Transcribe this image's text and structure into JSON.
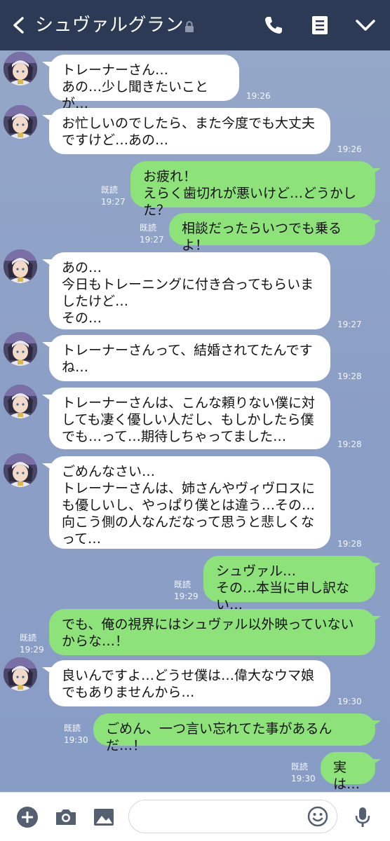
{
  "header": {
    "title": "シュヴァルグラン",
    "icons": [
      "back-icon",
      "lock-icon",
      "phone-icon",
      "menu-note-icon",
      "chevron-down-icon"
    ]
  },
  "colors": {
    "header_bg": "#2c3a55",
    "chat_bg": "#8a9ec3",
    "my_bubble": "#8ee27a",
    "their_bubble": "#ffffff"
  },
  "messages": [
    {
      "side": "left",
      "text": "トレーナーさん…\nあの…少し聞きたいことが…",
      "time": "19:26"
    },
    {
      "side": "left",
      "text": "お忙しいのでしたら、また今度でも大丈夫\nですけど…あの…",
      "time": "19:26"
    },
    {
      "side": "right",
      "text": "お疲れ！\nえらく歯切れが悪いけど…どうかした？",
      "time": "19:27",
      "read": "既読"
    },
    {
      "side": "right",
      "text": "相談だったらいつでも乗るよ！",
      "time": "19:27",
      "read": "既読"
    },
    {
      "side": "left",
      "text": "あの…\n今日もトレーニングに付き合ってもらいま\nしたけど…\nその…",
      "time": "19:27"
    },
    {
      "side": "left",
      "text": "トレーナーさんって、結婚されてたんです\nね…",
      "time": "19:28"
    },
    {
      "side": "left",
      "text": "トレーナーさんは、こんな頼りない僕に対\nしても凄く優しい人だし、もしかしたら僕\nでも…って…期待しちゃってました…",
      "time": "19:28"
    },
    {
      "side": "left",
      "text": "ごめんなさい…\nトレーナーさんは、姉さんやヴィヴロスに\nも優しいし、やっぱり僕とは違う…その…\n向こう側の人なんだなって思うと悲しくな\nって…",
      "time": "19:28"
    },
    {
      "side": "right",
      "text": "シュヴァル…\nその…本当に申し訳ない…",
      "time": "19:29",
      "read": "既読"
    },
    {
      "side": "right",
      "text": "でも、俺の視界にはシュヴァル以外映っていない\nからな…！",
      "time": "19:29",
      "read": "既読"
    },
    {
      "side": "left",
      "text": "良いんですよ…どうせ僕は…偉大なウマ娘\nでもありませんから…",
      "time": "19:30"
    },
    {
      "side": "right",
      "text": "ごめん、一つ言い忘れてた事があるんだ…！",
      "time": "19:30",
      "read": "既読"
    },
    {
      "side": "right",
      "text": "実は…",
      "time": "19:30",
      "read": "既読"
    }
  ],
  "footer": {
    "icons": [
      "add-icon",
      "camera-icon",
      "image-icon",
      "emoji-icon",
      "microphone-icon"
    ],
    "input_value": ""
  }
}
